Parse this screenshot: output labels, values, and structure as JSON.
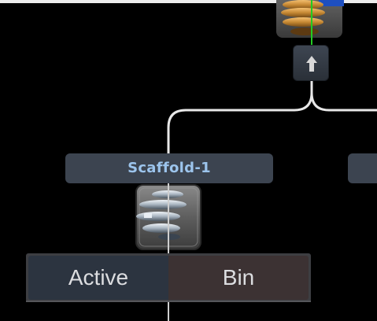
{
  "node": {
    "label": "Scaffold-1"
  },
  "mode_toggle": {
    "active_label": "Active",
    "bin_label": "Bin",
    "selected": "Active"
  },
  "icons": {
    "upstream_node": "upstream-node-icon",
    "port_arrow": "arrow-up-icon",
    "scaffold": "scaffold-icon"
  },
  "colors": {
    "background": "#000000",
    "wire": "#e8e8e8",
    "label_text": "#9cc4ec",
    "label_bg": "#3c4450",
    "active_bg": "#2c3440",
    "bin_bg": "#3c3233",
    "highlight_wire": "#22cc22"
  }
}
